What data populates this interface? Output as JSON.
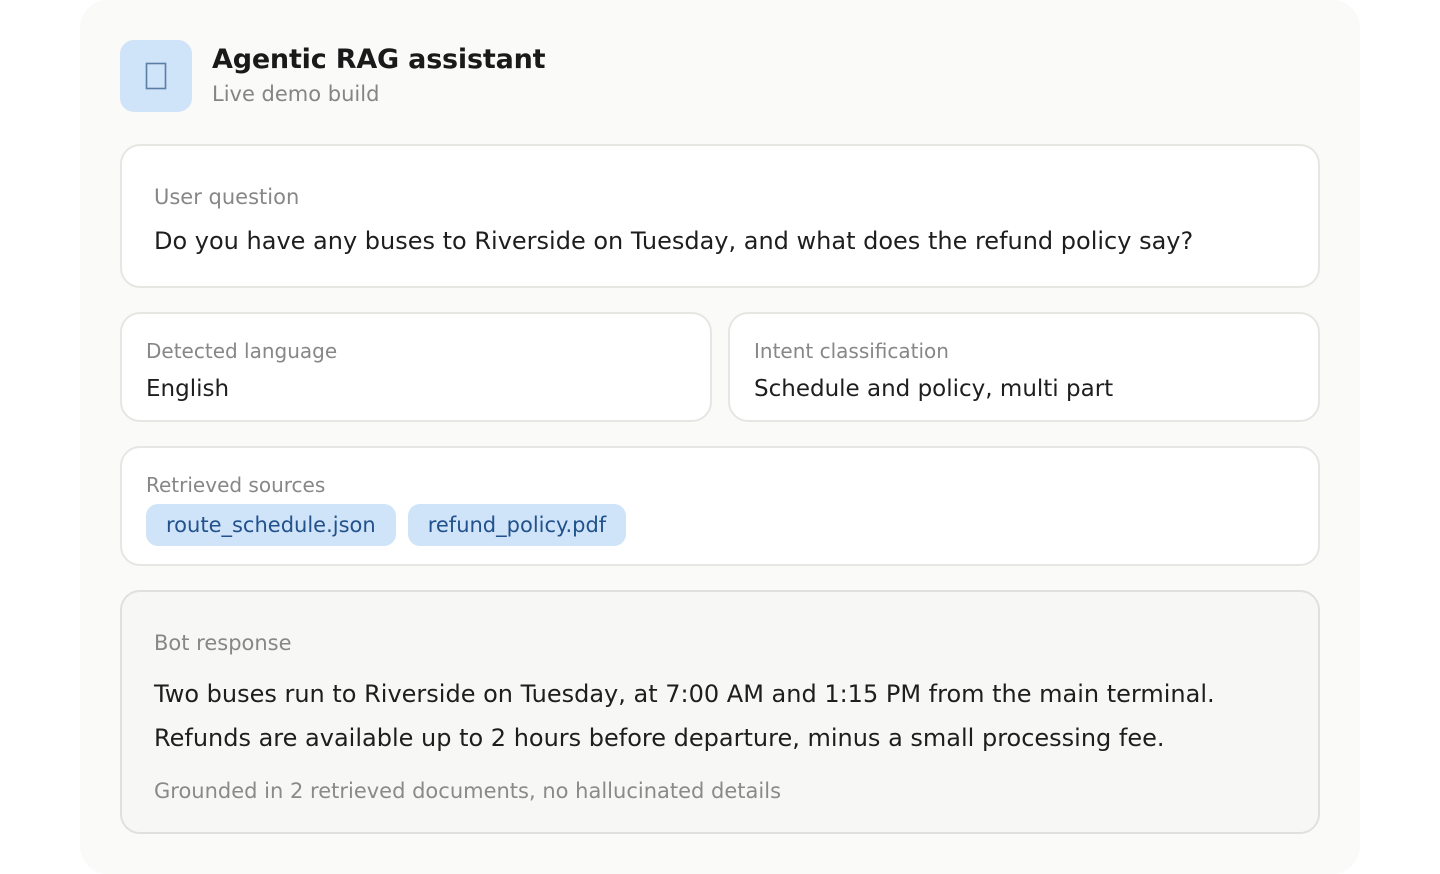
{
  "app": {
    "title": "Agentic RAG assistant",
    "subtitle": "Live demo build",
    "icon": "app-icon-placeholder"
  },
  "question": {
    "label": "User question",
    "text": "Do you have any buses to Riverside on Tuesday, and what does the refund policy say?"
  },
  "language": {
    "label": "Detected language",
    "value": "English"
  },
  "intent": {
    "label": "Intent classification",
    "value": "Schedule and policy, multi part"
  },
  "sources": {
    "label": "Retrieved sources",
    "items": [
      "route_schedule.json",
      "refund_policy.pdf"
    ]
  },
  "response": {
    "label": "Bot response",
    "lines": [
      "Two buses run to Riverside on Tuesday, at 7:00 AM and 1:15 PM from the main terminal.",
      "Refunds are available up to 2 hours before departure, minus a small processing fee."
    ],
    "note": "Grounded in 2 retrieved documents, no hallucinated details"
  },
  "colors": {
    "accent_bg": "#cfe3f9",
    "accent_text": "#22528c",
    "panel_bg": "#fafaf9",
    "border": "#e6e6e3"
  }
}
